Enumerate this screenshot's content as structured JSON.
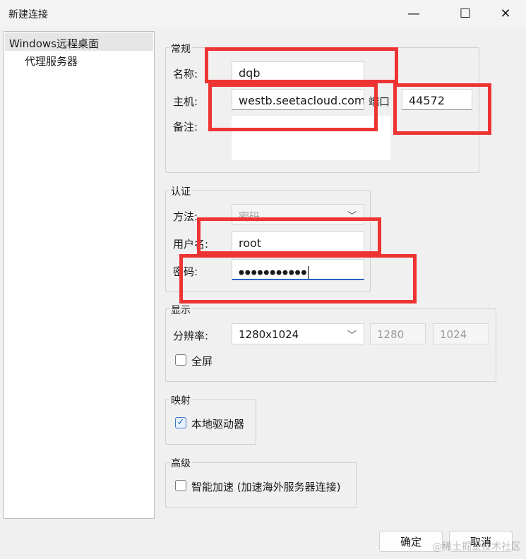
{
  "window": {
    "title": "新建连接",
    "minimize": "—",
    "maximize": "☐",
    "close": "✕"
  },
  "tree": {
    "items": [
      {
        "label": "Windows远程桌面",
        "selected": true
      },
      {
        "label": "代理服务器",
        "selected": false
      }
    ]
  },
  "general": {
    "legend": "常规",
    "name_label": "名称:",
    "name_value": "dqb",
    "host_label": "主机:",
    "host_value": "westb.seetacloud.com",
    "port_label": "端口",
    "port_value": "44572",
    "note_label": "备注:",
    "note_value": ""
  },
  "auth": {
    "legend": "认证",
    "method_label": "方法:",
    "method_value": "密码",
    "username_label": "用户名:",
    "username_value": "root",
    "password_label": "密码:",
    "password_masked": "●●●●●●●●●●●"
  },
  "display": {
    "legend": "显示",
    "resolution_label": "分辨率:",
    "resolution_value": "1280x1024",
    "width_value": "1280",
    "height_value": "1024",
    "fullscreen_label": "全屏",
    "fullscreen_checked": false
  },
  "mapping": {
    "legend": "映射",
    "local_drive_label": "本地驱动器",
    "local_drive_checked": true,
    "check_glyph": "✓"
  },
  "advanced": {
    "legend": "高级",
    "accel_label": "智能加速 (加速海外服务器连接)",
    "accel_checked": false
  },
  "buttons": {
    "ok": "确定",
    "cancel": "取消"
  },
  "watermark": "@稀土掘金技术社区",
  "colors": {
    "annotation": "#ee3333",
    "focus": "#2a63c7",
    "check_accent": "#1f5fbf"
  }
}
